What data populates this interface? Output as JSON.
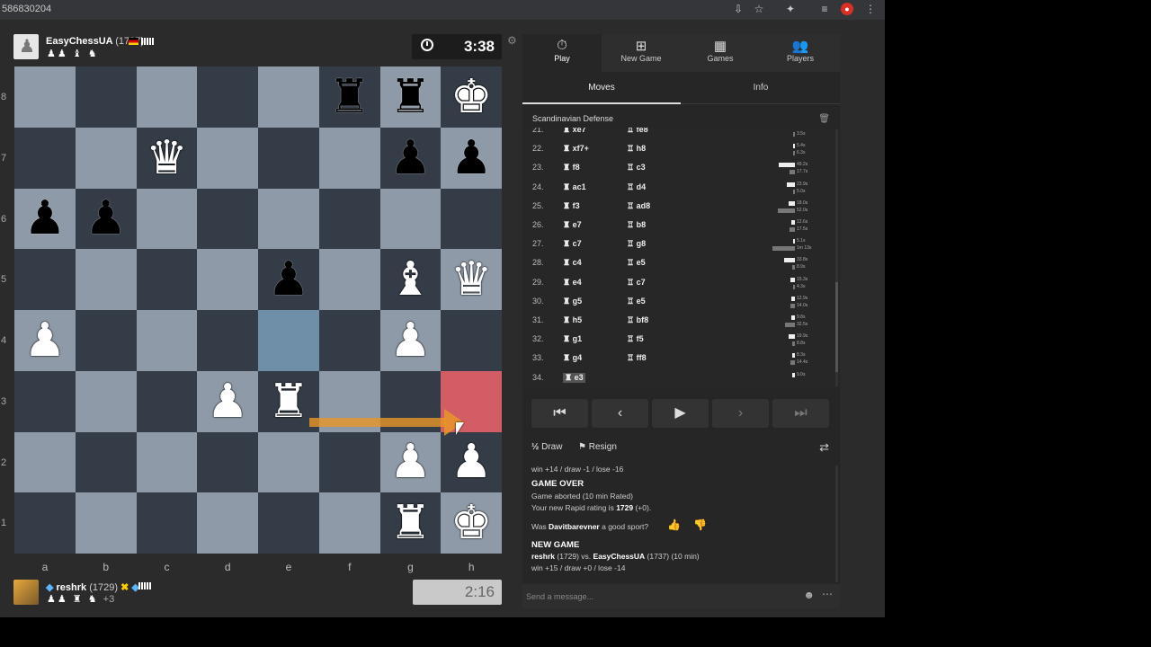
{
  "browser": {
    "url": "586830204"
  },
  "top_player": {
    "name": "EasyChessUA",
    "rating": "(1737)",
    "clock": "3:38"
  },
  "bottom_player": {
    "name": "reshrk",
    "rating": "(1729)",
    "extra": "+3",
    "clock": "2:16"
  },
  "board": {
    "files": [
      "a",
      "b",
      "c",
      "d",
      "e",
      "f",
      "g",
      "h"
    ],
    "ranks": [
      "8",
      "7",
      "6",
      "5",
      "4",
      "3",
      "2",
      "1"
    ],
    "pieces": {
      "f8": "bR",
      "g8": "bR",
      "h8": "wK",
      "c7": "wQ",
      "g7": "bP",
      "h7": "bP",
      "a6": "bP",
      "b6": "bP",
      "e5": "bP",
      "g5": "wB",
      "h5": "wQ",
      "a4": "wP",
      "g4": "wP",
      "d3": "wP",
      "e3": "wR",
      "g2": "wP",
      "h2": "wP",
      "g1": "wR",
      "h1": "wK"
    },
    "highlight_from": "e4",
    "highlight_to": "h3"
  },
  "nav": [
    {
      "label": "Play",
      "icon": "⏱"
    },
    {
      "label": "New Game",
      "icon": "⊞"
    },
    {
      "label": "Games",
      "icon": "▦"
    },
    {
      "label": "Players",
      "icon": "👥"
    }
  ],
  "tabs": {
    "moves": "Moves",
    "info": "Info"
  },
  "opening": "Scandinavian Defense",
  "moves": [
    {
      "num": "21.",
      "w": "xe7",
      "b": "fe8",
      "wt": "",
      "bt": "3.5s"
    },
    {
      "num": "22.",
      "w": "xf7+",
      "b": "h8",
      "wt": "5.4s",
      "bt": "6.3s"
    },
    {
      "num": "23.",
      "w": "f8",
      "b": "c3",
      "wt": "49.2s",
      "bt": "17.7s"
    },
    {
      "num": "24.",
      "w": "ac1",
      "b": "d4",
      "wt": "23.9s",
      "bt": "5.0s"
    },
    {
      "num": "25.",
      "w": "f3",
      "b": "ad8",
      "wt": "18.0s",
      "bt": "52.0s"
    },
    {
      "num": "26.",
      "w": "e7",
      "b": "b8",
      "wt": "12.6s",
      "bt": "17.5s"
    },
    {
      "num": "27.",
      "w": "c7",
      "b": "g8",
      "wt": "5.1s",
      "bt": "1m 13s"
    },
    {
      "num": "28.",
      "w": "c4",
      "b": "e5",
      "wt": "33.8s",
      "bt": "8.9s"
    },
    {
      "num": "29.",
      "w": "e4",
      "b": "c7",
      "wt": "15.3s",
      "bt": "4.3s"
    },
    {
      "num": "30.",
      "w": "g5",
      "b": "e5",
      "wt": "12.9s",
      "bt": "14.0s"
    },
    {
      "num": "31.",
      "w": "h5",
      "b": "bf8",
      "wt": "9.8s",
      "bt": "32.5s"
    },
    {
      "num": "32.",
      "w": "g1",
      "b": "f5",
      "wt": "19.9s",
      "bt": "8.8s"
    },
    {
      "num": "33.",
      "w": "g4",
      "b": "ff8",
      "wt": "8.3s",
      "bt": "14.4s"
    },
    {
      "num": "34.",
      "w": "e3",
      "b": "",
      "wt": "9.0s",
      "bt": ""
    }
  ],
  "time_bar_fractions": [
    [
      0,
      0.05
    ],
    [
      0.05,
      0.07
    ],
    [
      0.6,
      0.2
    ],
    [
      0.3,
      0.06
    ],
    [
      0.22,
      0.62
    ],
    [
      0.15,
      0.2
    ],
    [
      0.06,
      0.85
    ],
    [
      0.4,
      0.1
    ],
    [
      0.18,
      0.05
    ],
    [
      0.15,
      0.17
    ],
    [
      0.12,
      0.38
    ],
    [
      0.24,
      0.1
    ],
    [
      0.1,
      0.17
    ],
    [
      0.1,
      0
    ]
  ],
  "controls": {
    "first": "⏮",
    "prev": "‹",
    "play": "▶",
    "next": "›",
    "last": "⏭"
  },
  "actions": {
    "draw_icon": "½",
    "draw": "Draw",
    "resign_icon": "⚑",
    "resign": "Resign"
  },
  "chat": {
    "line1": "win +14 / draw -1 / lose -16",
    "game_over": "GAME OVER",
    "aborted": "Game aborted (10 min Rated)",
    "rating_prefix": "Your new Rapid rating is ",
    "rating_value": "1729",
    "rating_suffix": " (+0).",
    "sport_prefix": "Was ",
    "sport_name": "Davitbarevner",
    "sport_suffix": " a good sport?",
    "new_game": "NEW GAME",
    "match_white": "reshrk",
    "match_white_rating": " (1729) vs. ",
    "match_black": "EasyChessUA",
    "match_black_rating": " (1737) (10 min)",
    "line_last": "win +15 / draw +0 / lose -14"
  },
  "message_placeholder": "Send a message..."
}
